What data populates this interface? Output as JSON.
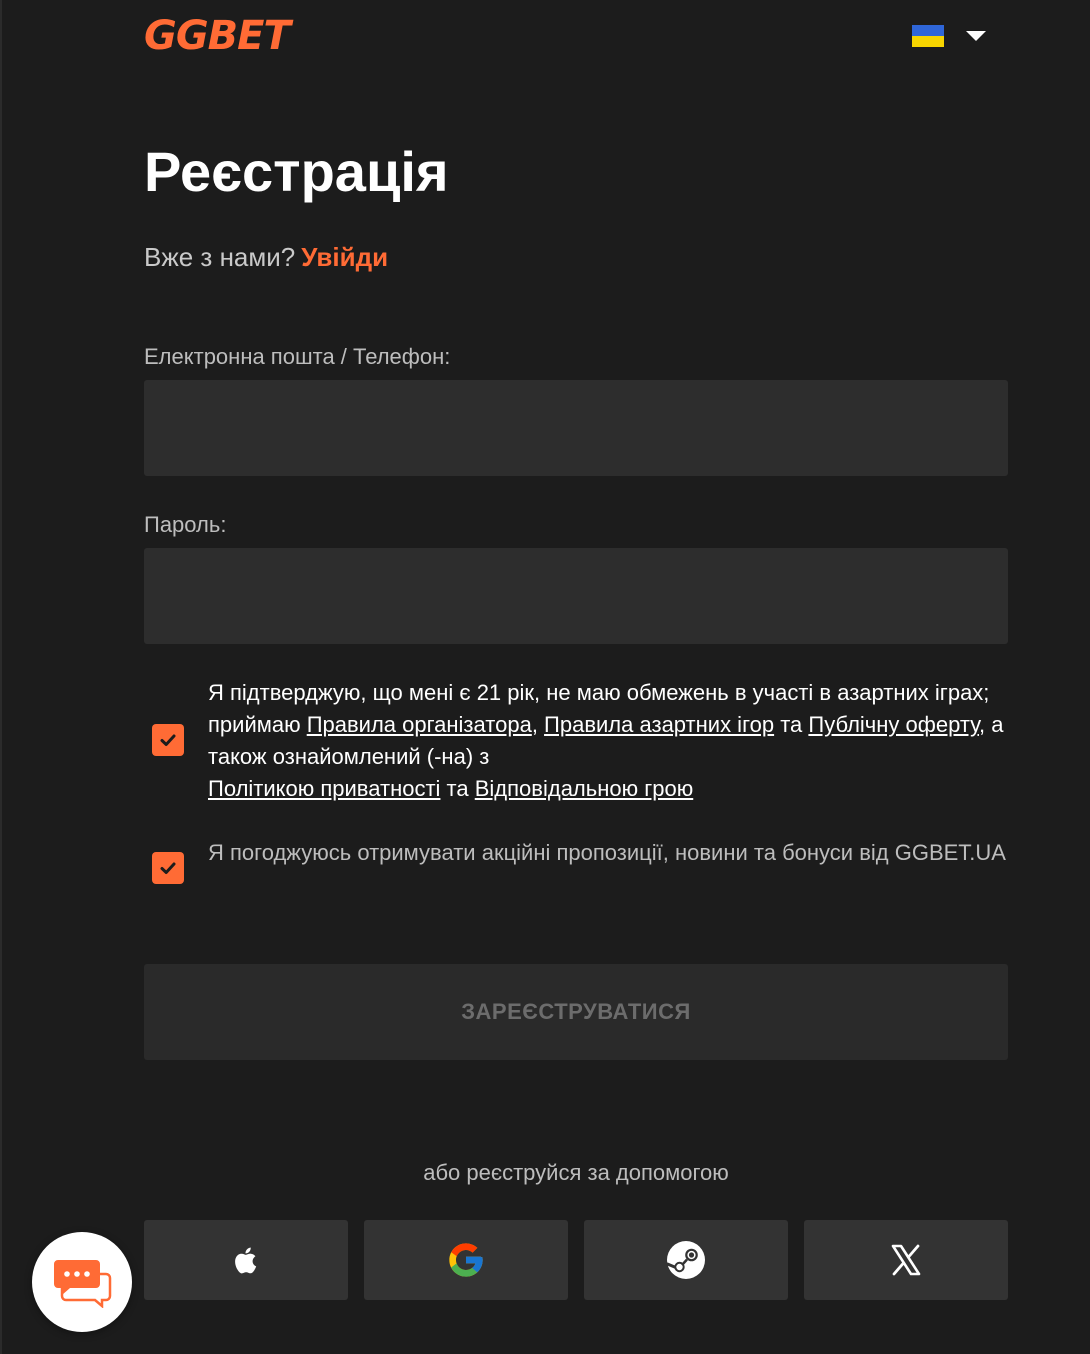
{
  "header": {
    "logo_text": "GGBET",
    "language": "uk"
  },
  "title": "Реєстрація",
  "login_prompt": {
    "text": "Вже з нами?",
    "link": "Увійди"
  },
  "form": {
    "email_label": "Електронна пошта / Телефон:",
    "email_value": "",
    "password_label": "Пароль:",
    "password_value": ""
  },
  "terms": {
    "checked": true,
    "text_1": "Я підтверджую, що мені є 21 рік, не маю обмежень в участі в азартних іграх; приймаю ",
    "link_rules_organizer": "Правила організатора",
    "sep_1": ", ",
    "link_rules_gambling": "Правила азартних ігор",
    "text_2": " та ",
    "link_public_offer": "Публічну оферту",
    "text_3": ", а також ознайомлений (-на) з ",
    "link_privacy": "Політикою приватності",
    "text_4": " та ",
    "link_responsible": "Відповідальною грою"
  },
  "promo": {
    "checked": true,
    "text": "Я погоджуюсь отримувати акційні пропозиції, новини та бонуси від GGBET.UA"
  },
  "submit_label": "ЗАРЕЄСТРУВАТИСЯ",
  "social": {
    "caption": "або реєструйся за допомогою",
    "providers": [
      "apple-icon",
      "google-icon",
      "steam-icon",
      "x-icon"
    ]
  },
  "colors": {
    "accent": "#ff6b35",
    "background": "#1c1c1c",
    "field": "#2d2d2d"
  }
}
